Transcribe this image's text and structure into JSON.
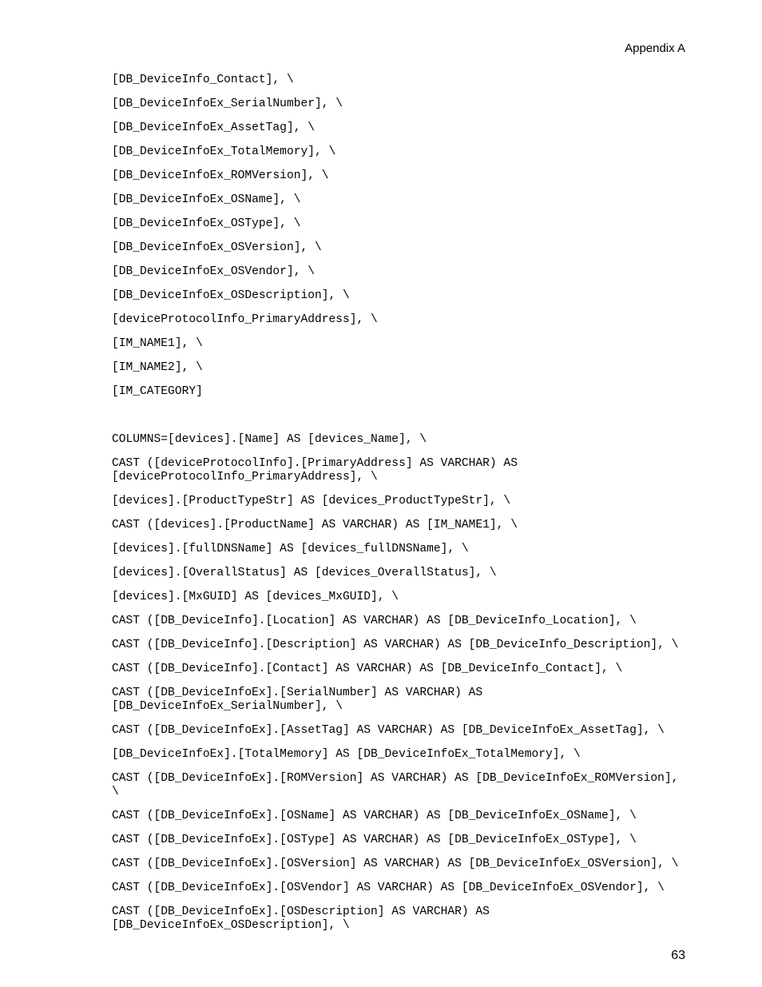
{
  "header": "Appendix A",
  "page_number": "63",
  "code_lines": [
    "[DB_DeviceInfo_Contact], \\",
    "[DB_DeviceInfoEx_SerialNumber], \\",
    "[DB_DeviceInfoEx_AssetTag], \\",
    "[DB_DeviceInfoEx_TotalMemory], \\",
    "[DB_DeviceInfoEx_ROMVersion], \\",
    "[DB_DeviceInfoEx_OSName], \\",
    "[DB_DeviceInfoEx_OSType], \\",
    "[DB_DeviceInfoEx_OSVersion], \\",
    "[DB_DeviceInfoEx_OSVendor], \\",
    "[DB_DeviceInfoEx_OSDescription], \\",
    "[deviceProtocolInfo_PrimaryAddress], \\",
    "[IM_NAME1], \\",
    "[IM_NAME2], \\",
    "[IM_CATEGORY]",
    "",
    "COLUMNS=[devices].[Name] AS [devices_Name], \\",
    "CAST ([deviceProtocolInfo].[PrimaryAddress] AS VARCHAR) AS [deviceProtocolInfo_PrimaryAddress], \\",
    "[devices].[ProductTypeStr] AS [devices_ProductTypeStr], \\",
    "CAST ([devices].[ProductName] AS VARCHAR) AS [IM_NAME1], \\",
    "[devices].[fullDNSName] AS [devices_fullDNSName], \\",
    "[devices].[OverallStatus] AS [devices_OverallStatus], \\",
    "[devices].[MxGUID] AS [devices_MxGUID], \\",
    "CAST ([DB_DeviceInfo].[Location] AS VARCHAR) AS [DB_DeviceInfo_Location], \\",
    "CAST ([DB_DeviceInfo].[Description] AS VARCHAR) AS [DB_DeviceInfo_Description], \\",
    "CAST ([DB_DeviceInfo].[Contact] AS VARCHAR) AS [DB_DeviceInfo_Contact], \\",
    "CAST ([DB_DeviceInfoEx].[SerialNumber] AS VARCHAR) AS [DB_DeviceInfoEx_SerialNumber], \\",
    "CAST ([DB_DeviceInfoEx].[AssetTag] AS VARCHAR) AS [DB_DeviceInfoEx_AssetTag], \\",
    "[DB_DeviceInfoEx].[TotalMemory] AS [DB_DeviceInfoEx_TotalMemory], \\",
    "CAST ([DB_DeviceInfoEx].[ROMVersion] AS VARCHAR) AS [DB_DeviceInfoEx_ROMVersion], \\",
    "CAST ([DB_DeviceInfoEx].[OSName] AS VARCHAR) AS [DB_DeviceInfoEx_OSName], \\",
    "CAST ([DB_DeviceInfoEx].[OSType] AS VARCHAR) AS [DB_DeviceInfoEx_OSType], \\",
    "CAST ([DB_DeviceInfoEx].[OSVersion] AS VARCHAR) AS [DB_DeviceInfoEx_OSVersion], \\",
    "CAST ([DB_DeviceInfoEx].[OSVendor] AS VARCHAR) AS [DB_DeviceInfoEx_OSVendor], \\",
    "CAST ([DB_DeviceInfoEx].[OSDescription] AS VARCHAR) AS [DB_DeviceInfoEx_OSDescription], \\"
  ]
}
